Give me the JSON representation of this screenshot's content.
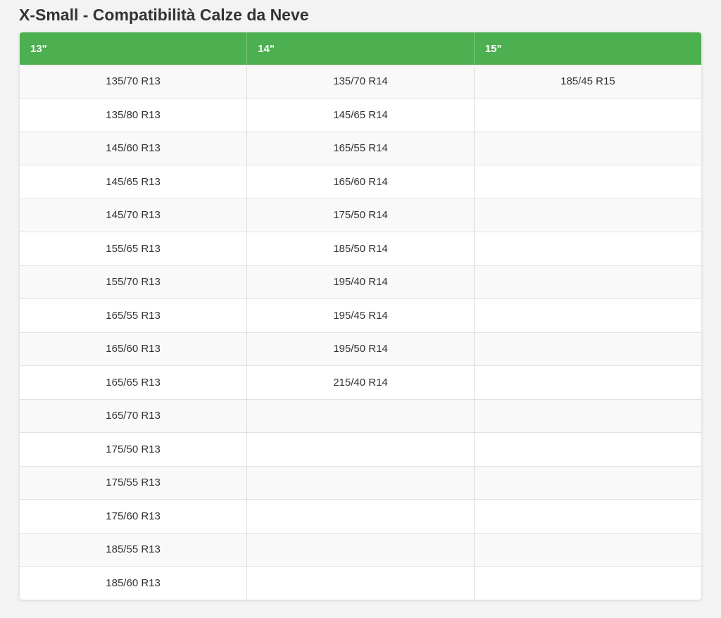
{
  "page": {
    "title": "X-Small - Compatibilità Calze da Neve"
  },
  "table": {
    "headers": [
      "13\"",
      "14\"",
      "15\""
    ],
    "header_color": "#4caf50",
    "rows": [
      [
        "135/70 R13",
        "135/70 R14",
        "185/45 R15"
      ],
      [
        "135/80 R13",
        "145/65 R14",
        ""
      ],
      [
        "145/60 R13",
        "165/55 R14",
        ""
      ],
      [
        "145/65 R13",
        "165/60 R14",
        ""
      ],
      [
        "145/70 R13",
        "175/50 R14",
        ""
      ],
      [
        "155/65 R13",
        "185/50 R14",
        ""
      ],
      [
        "155/70 R13",
        "195/40 R14",
        ""
      ],
      [
        "165/55 R13",
        "195/45 R14",
        ""
      ],
      [
        "165/60 R13",
        "195/50 R14",
        ""
      ],
      [
        "165/65 R13",
        "215/40 R14",
        ""
      ],
      [
        "165/70 R13",
        "",
        ""
      ],
      [
        "175/50 R13",
        "",
        ""
      ],
      [
        "175/55 R13",
        "",
        ""
      ],
      [
        "175/60 R13",
        "",
        ""
      ],
      [
        "185/55 R13",
        "",
        ""
      ],
      [
        "185/60 R13",
        "",
        ""
      ]
    ]
  }
}
